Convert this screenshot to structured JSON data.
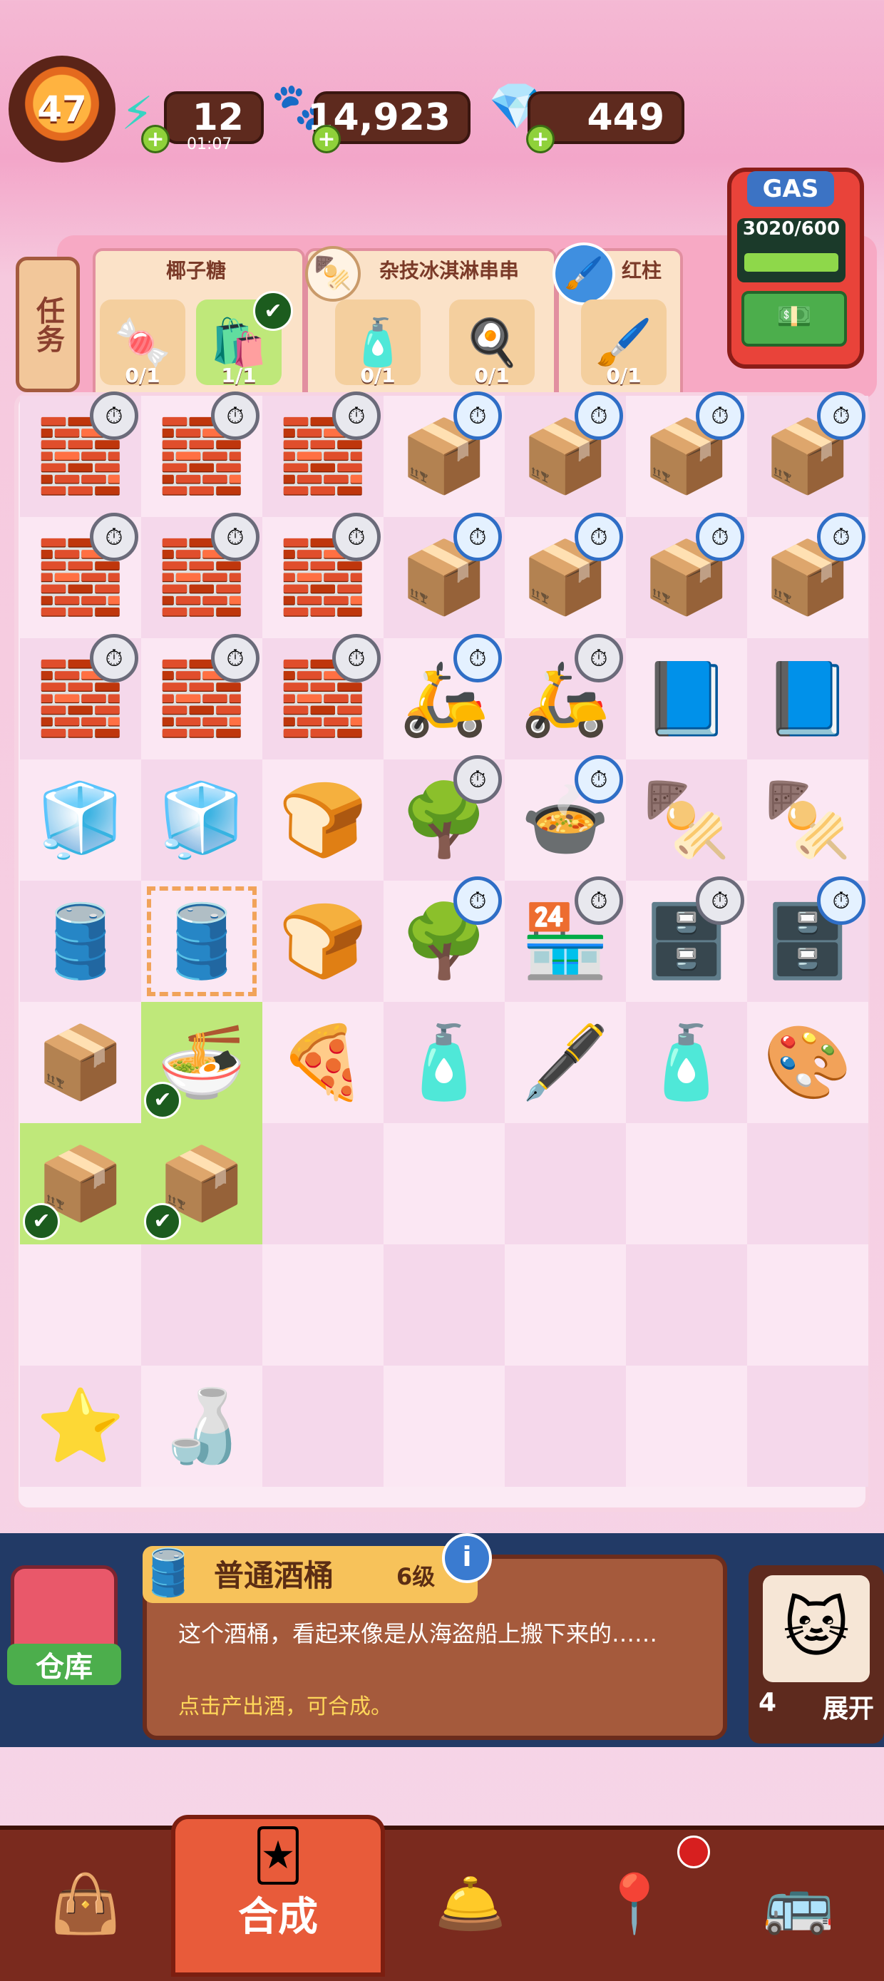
{
  "player": {
    "level": "47"
  },
  "resources": {
    "energy": {
      "value": "12",
      "timer": "01:07",
      "icon": "lightning-icon"
    },
    "coins": {
      "value": "14,923",
      "icon": "paw-coin-icon"
    },
    "gems": {
      "value": "449",
      "icon": "diamond-icon"
    }
  },
  "tasks": {
    "tab_label": "任务",
    "groups": [
      {
        "title": "椰子糖",
        "items": [
          {
            "icon": "candy",
            "count": "0/1"
          },
          {
            "icon": "box",
            "count": "1/1",
            "done": true
          }
        ]
      },
      {
        "title": "杂技冰淇淋串串",
        "items": [
          {
            "icon": "sauce-bottle",
            "count": "0/1"
          },
          {
            "icon": "egg-yolk",
            "count": "0/1"
          }
        ]
      },
      {
        "title": "红柱",
        "items": [
          {
            "icon": "paint-brush",
            "count": "0/1"
          }
        ]
      }
    ]
  },
  "gas": {
    "label": "GAS",
    "reading": "3020/600"
  },
  "board": {
    "rows": [
      [
        "🧱",
        "🧱",
        "🧱",
        "📦",
        "📦",
        "📦",
        "📦"
      ],
      [
        "🧱",
        "🧱",
        "🧱",
        "📦",
        "📦",
        "📦",
        "📦"
      ],
      [
        "🧱",
        "🧱",
        "🧱",
        "🛵",
        "🛵",
        "📘",
        "📘"
      ],
      [
        "🧊",
        "🧊",
        "🍞",
        "🌳",
        "🍲",
        "🍢",
        "🍢"
      ],
      [
        "🛢️",
        "🛢️",
        "🍞",
        "🌳",
        "🏪",
        "🗄️",
        "🗄️"
      ],
      [
        "📦",
        "🍜",
        "🍕",
        "🧴",
        "🖋️",
        "🧴",
        "🎨"
      ],
      [
        "📦",
        "📦",
        "",
        "",
        "",
        "",
        ""
      ],
      [
        "",
        "",
        "",
        "",
        "",
        "",
        ""
      ],
      [
        "⭐",
        "🍶",
        "",
        "",
        "",
        "",
        ""
      ]
    ]
  },
  "selected_item": {
    "name": "普通酒桶",
    "level": "6级",
    "description": "这个酒桶，看起来像是从海盗船上搬下来的……",
    "hint": "点击产出酒，可合成。"
  },
  "warehouse": {
    "label": "仓库"
  },
  "expand": {
    "count": "4",
    "label": "展开"
  },
  "nav": {
    "active_label": "合成"
  }
}
